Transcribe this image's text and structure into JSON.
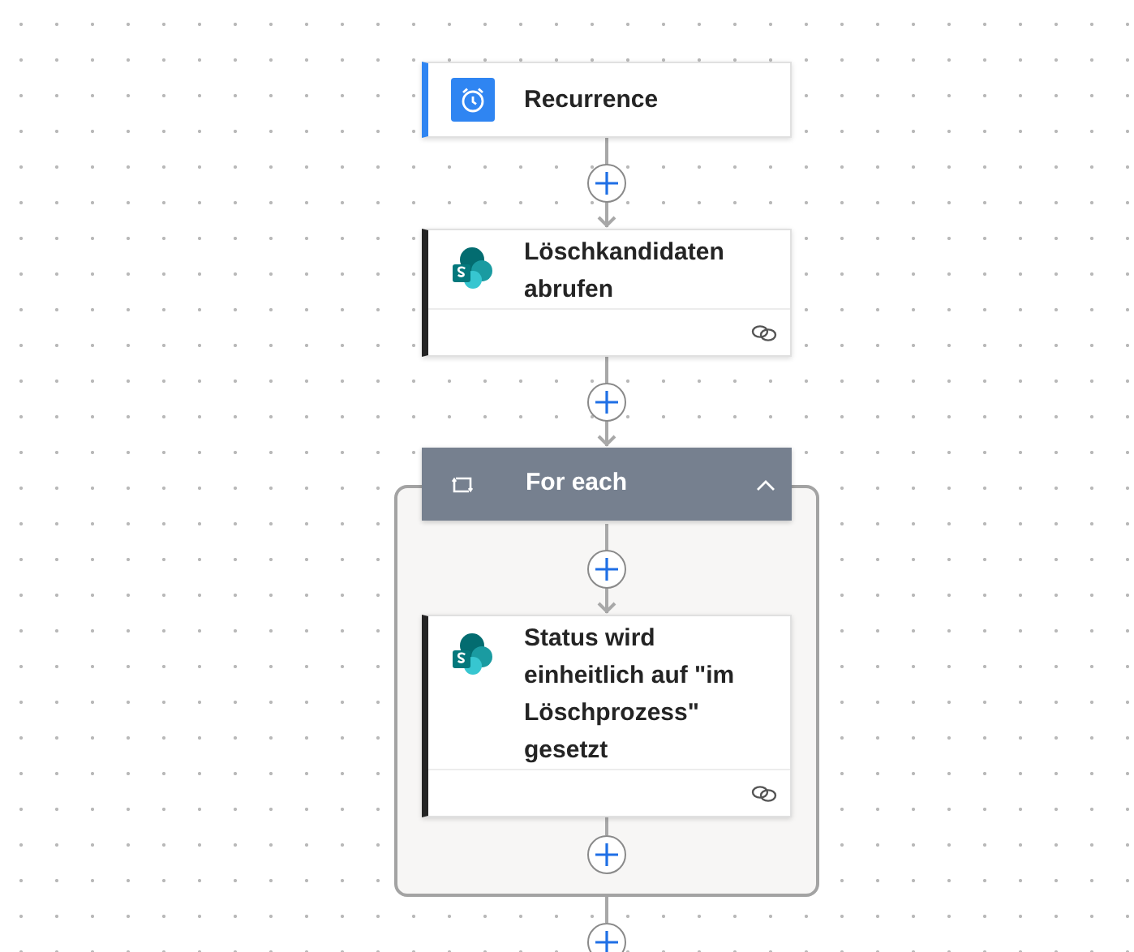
{
  "steps": [
    {
      "kind": "trigger",
      "title": "Recurrence"
    },
    {
      "kind": "action",
      "title": "Löschkandidaten abrufen"
    },
    {
      "kind": "loop",
      "title": "For each",
      "expanded": true,
      "children": [
        {
          "kind": "action",
          "title": "Status wird einheitlich auf \"im Löschprozess\" gesetzt"
        }
      ]
    }
  ]
}
